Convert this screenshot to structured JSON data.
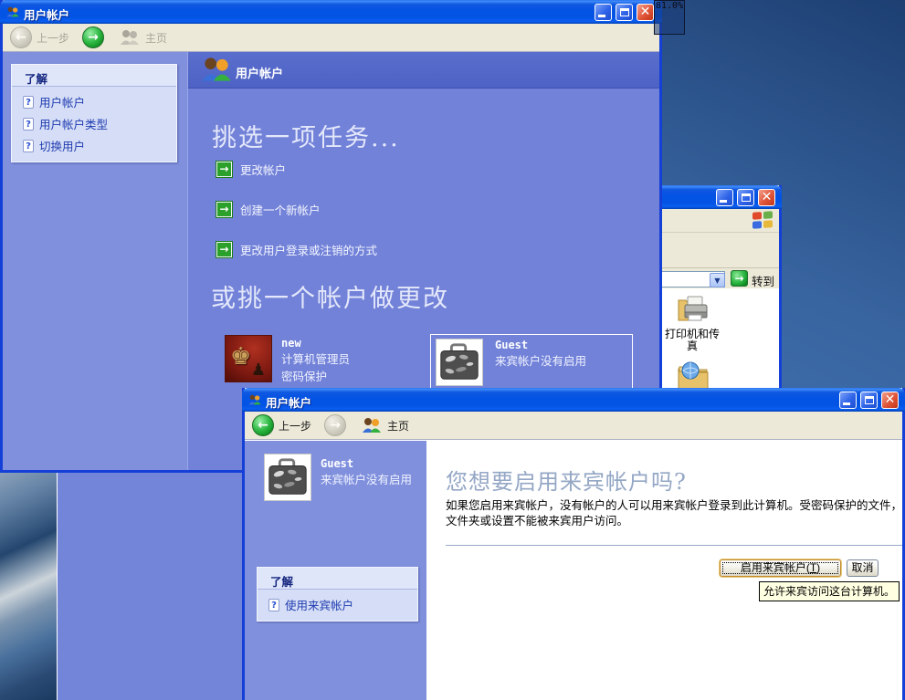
{
  "screen": {
    "zoom_indicator": "81.0%"
  },
  "colors": {
    "titlebar_blue": "#0353e4",
    "window_border_blue": "#1440d8",
    "toolbar_beige": "#ece9d8",
    "content_periwinkle": "#7282d8",
    "sidebar_periwinkle": "#8090dd",
    "header_band_blue": "#4d62c4",
    "learn_box_bg": "#d5def6",
    "learn_link_blue": "#1f3bb0",
    "task_icon_green": "#2ba12b",
    "desktop_blue": "#3f70ad",
    "tooltip_yellow": "#ffffe1",
    "heading_pale_blue": "#94a7c5"
  },
  "window_main": {
    "title": "用户帐户",
    "toolbar": {
      "back_label": "上一步",
      "home_label": "主页"
    },
    "sidebar": {
      "learn_title": "了解",
      "items": [
        {
          "label": "用户帐户"
        },
        {
          "label": "用户帐户类型"
        },
        {
          "label": "切换用户"
        }
      ]
    },
    "header_title": "用户帐户",
    "task_heading": "挑选一项任务...",
    "tasks": [
      {
        "label": "更改帐户"
      },
      {
        "label": "创建一个新帐户"
      },
      {
        "label": "更改用户登录或注销的方式"
      }
    ],
    "account_heading": "或挑一个帐户做更改",
    "accounts": [
      {
        "name": "new",
        "line1": "计算机管理员",
        "line2": "密码保护"
      },
      {
        "name": "Guest",
        "line1": "来宾帐户没有启用"
      }
    ]
  },
  "window_explorer": {
    "go_label": "转到",
    "items": [
      {
        "label_line1": "打印机和传",
        "label_line2": "真"
      }
    ]
  },
  "window_guest": {
    "title": "用户帐户",
    "toolbar": {
      "back_label": "上一步",
      "home_label": "主页"
    },
    "sidebar": {
      "account_name": "Guest",
      "account_status": "来宾帐户没有启用",
      "learn_title": "了解",
      "items": [
        {
          "label": "使用来宾帐户"
        }
      ]
    },
    "main": {
      "heading": "您想要启用来宾帐户吗?",
      "body": "如果您启用来宾帐户，没有帐户的人可以用来宾帐户登录到此计算机。受密码保护的文件，文件夹或设置不能被来宾用户访问。",
      "enable_button_prefix": "启用来宾帐户(",
      "enable_button_mnemonic": "T",
      "enable_button_suffix": ")",
      "cancel_button_label": "取消",
      "tooltip": "允许来宾访问这台计算机。"
    }
  }
}
